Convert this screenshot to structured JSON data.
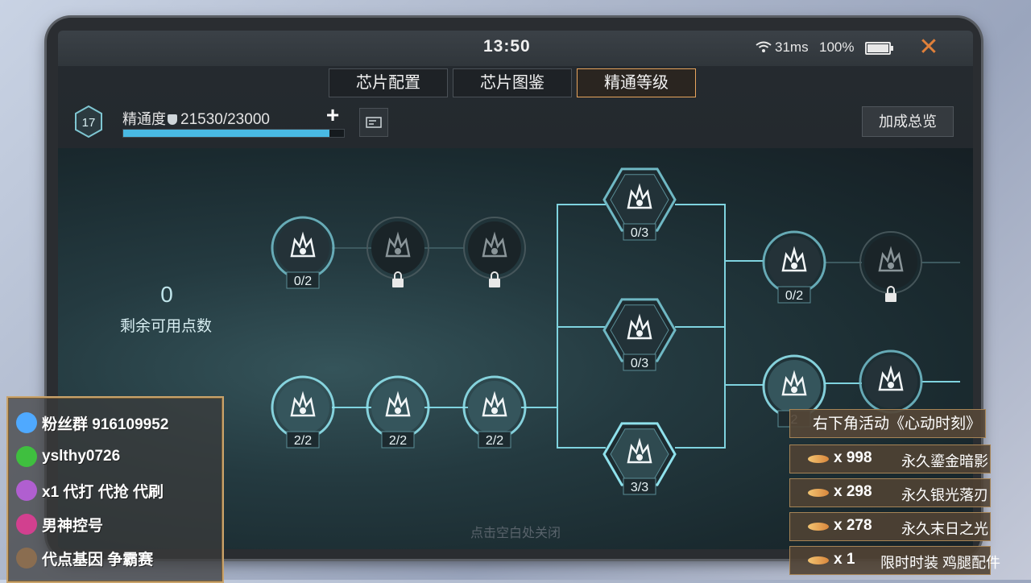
{
  "status_bar": {
    "time": "13:50",
    "ping": "31ms",
    "battery": "100%",
    "battery_level": 1.0
  },
  "tabs": [
    {
      "label": "芯片配置",
      "active": false
    },
    {
      "label": "芯片图鉴",
      "active": false
    },
    {
      "label": "精通等级",
      "active": true
    }
  ],
  "mastery": {
    "level": "17",
    "label": "精通度",
    "value": "21530/23000",
    "progress_fraction": 0.936
  },
  "summary_button": "加成总览",
  "points": {
    "remaining": "0",
    "label": "剩余可用点数"
  },
  "bottom_hint": "点击空白处关闭",
  "nodes": [
    {
      "id": "n1",
      "icon": "flame-shield-up-icon",
      "progress": "0/2",
      "locked": false
    },
    {
      "id": "n2",
      "icon": "crosshair-icon",
      "progress": "",
      "locked": true
    },
    {
      "id": "n3",
      "icon": "pistol-icon",
      "progress": "",
      "locked": true
    },
    {
      "id": "n4",
      "icon": "burning-magazine-icon",
      "progress": "0/3",
      "locked": false
    },
    {
      "id": "n5",
      "icon": "flame-shield-up-icon",
      "progress": "0/2",
      "locked": false
    },
    {
      "id": "n6",
      "icon": "heart-shield-icon",
      "progress": "",
      "locked": true
    },
    {
      "id": "n7",
      "icon": "shield-flame-icon",
      "progress": "2/2",
      "locked": false
    },
    {
      "id": "n8",
      "icon": "soldier-silhouette-icon",
      "progress": "2/2",
      "locked": false
    },
    {
      "id": "n9",
      "icon": "body-armor-icon",
      "progress": "2/2",
      "locked": false
    },
    {
      "id": "n10",
      "icon": "rifle-grass-icon",
      "progress": "0/3",
      "locked": false
    },
    {
      "id": "n11",
      "icon": "blades-icon",
      "progress": "3/3",
      "locked": false
    },
    {
      "id": "n12",
      "icon": "flame-shield-up-icon",
      "progress": "2",
      "locked": false
    },
    {
      "id": "n13",
      "icon": "armor-up-icon",
      "progress": "",
      "locked": false
    }
  ],
  "overlay_left": [
    {
      "icon": "qq-icon",
      "text": "粉丝群 916109952",
      "color": "#4fa9ff"
    },
    {
      "icon": "wechat-icon",
      "text": "yslthy0726",
      "color": "#3fbf3f"
    },
    {
      "icon": "rocket-icon",
      "text": "x1 代打 代抢 代刷",
      "color": "#b05fd0"
    },
    {
      "icon": "heart-gift-icon",
      "text": "男神控号",
      "color": "#d2408f"
    },
    {
      "icon": "card-icon",
      "text": "代点基因 争霸赛",
      "color": "#8a6d50"
    }
  ],
  "overlay_right": {
    "title": "右下角活动《心动时刻》",
    "rows": [
      {
        "count": "x 998",
        "name": "永久鎏金暗影"
      },
      {
        "count": "x 298",
        "name": "永久银光落刃"
      },
      {
        "count": "x 278",
        "name": "永久末日之光"
      },
      {
        "count": "x 1",
        "name": "限时时装 鸡腿配件"
      }
    ]
  }
}
